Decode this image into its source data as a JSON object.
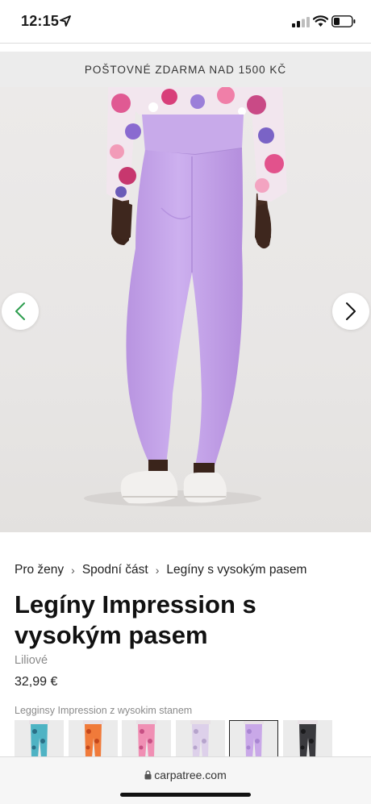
{
  "status_bar": {
    "time": "12:15"
  },
  "promo": {
    "text": "POŠTOVNÉ ZDARMA NAD 1500 KČ"
  },
  "breadcrumb": [
    "Pro ženy",
    "Spodní část",
    "Legíny s vysokým pasem"
  ],
  "product": {
    "title": "Legíny Impression s vysokým pasem",
    "color": "Liliové",
    "price": "32,99 €",
    "variant_label": "Legginsy Impression z wysokim stanem"
  },
  "variants": [
    {
      "color": "#4fb3c4",
      "accent": "#2a6f86"
    },
    {
      "color": "#f07a3a",
      "accent": "#c4471c"
    },
    {
      "color": "#f08fb4",
      "accent": "#c75084"
    },
    {
      "color": "#ddd0ea",
      "accent": "#b6a4cc"
    },
    {
      "color": "#c9a8e8",
      "accent": "#a986d2",
      "selected": true
    },
    {
      "color": "#3a3a3e",
      "accent": "#1a1a1c"
    }
  ],
  "browser": {
    "url": "carpatree.com"
  },
  "colors": {
    "legging": "#c6a6ea",
    "accent_green": "#2e9e4f"
  },
  "icons": [
    "location-arrow-icon",
    "signal-icon",
    "wifi-icon",
    "battery-icon",
    "chevron-left-icon",
    "chevron-right-icon",
    "lock-icon"
  ]
}
